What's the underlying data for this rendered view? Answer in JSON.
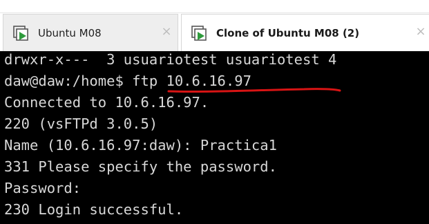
{
  "tabs": [
    {
      "label": "Ubuntu M08",
      "icon": "vm-icon",
      "close": "×",
      "active": false
    },
    {
      "label": "Clone of Ubuntu M08 (2)",
      "icon": "vm-icon",
      "close": "×",
      "active": true
    }
  ],
  "terminal": {
    "lines": [
      "drwxr-x---  3 usuariotest usuariotest 4",
      "daw@daw:/home$ ftp 10.6.16.97",
      "Connected to 10.6.16.97.",
      "220 (vsFTPd 3.0.5)",
      "Name (10.6.16.97:daw): Practica1",
      "331 Please specify the password.",
      "Password:",
      "230 Login successful."
    ]
  },
  "colors": {
    "terminal_bg": "#000000",
    "terminal_fg": "#d8d8d8",
    "annotation": "#d81414",
    "icon_green": "#2e9b3c"
  }
}
